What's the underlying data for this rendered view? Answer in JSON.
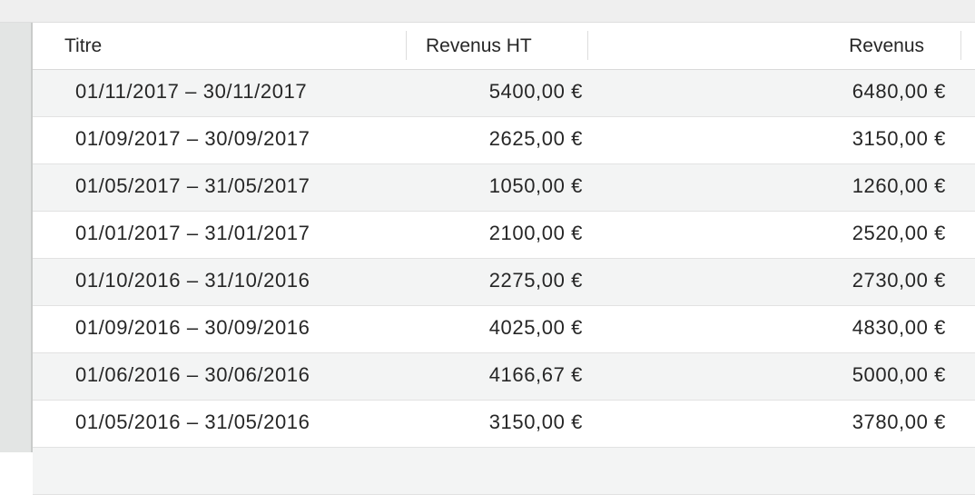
{
  "table": {
    "columns": [
      "Titre",
      "Revenus HT",
      "Revenus"
    ],
    "rows": [
      {
        "title": "01/11/2017 – 30/11/2017",
        "revenus_ht": "5400,00 €",
        "revenus": "6480,00 €"
      },
      {
        "title": "01/09/2017 – 30/09/2017",
        "revenus_ht": "2625,00 €",
        "revenus": "3150,00 €"
      },
      {
        "title": "01/05/2017 – 31/05/2017",
        "revenus_ht": "1050,00 €",
        "revenus": "1260,00 €"
      },
      {
        "title": "01/01/2017 – 31/01/2017",
        "revenus_ht": "2100,00 €",
        "revenus": "2520,00 €"
      },
      {
        "title": "01/10/2016 – 31/10/2016",
        "revenus_ht": "2275,00 €",
        "revenus": "2730,00 €"
      },
      {
        "title": "01/09/2016 – 30/09/2016",
        "revenus_ht": "4025,00 €",
        "revenus": "4830,00 €"
      },
      {
        "title": "01/06/2016 – 30/06/2016",
        "revenus_ht": "4166,67 €",
        "revenus": "5000,00 €"
      },
      {
        "title": "01/05/2016 – 31/05/2016",
        "revenus_ht": "3150,00 €",
        "revenus": "3780,00 €"
      }
    ]
  }
}
